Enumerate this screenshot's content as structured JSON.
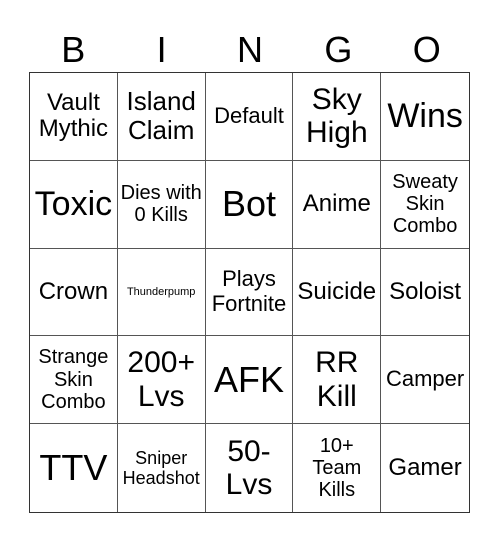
{
  "header": [
    "B",
    "I",
    "N",
    "G",
    "O"
  ],
  "cells": [
    [
      "Vault Mythic",
      "Island Claim",
      "Default",
      "Sky High",
      "Wins"
    ],
    [
      "Toxic",
      "Dies with 0 Kills",
      "Bot",
      "Anime",
      "Sweaty Skin Combo"
    ],
    [
      "Crown",
      "Thunderpump",
      "Plays Fortnite",
      "Suicide",
      "Soloist"
    ],
    [
      "Strange Skin Combo",
      "200+ Lvs",
      "AFK",
      "RR Kill",
      "Camper"
    ],
    [
      "TTV",
      "Sniper Headshot",
      "50- Lvs",
      "10+ Team Kills",
      "Gamer"
    ]
  ]
}
